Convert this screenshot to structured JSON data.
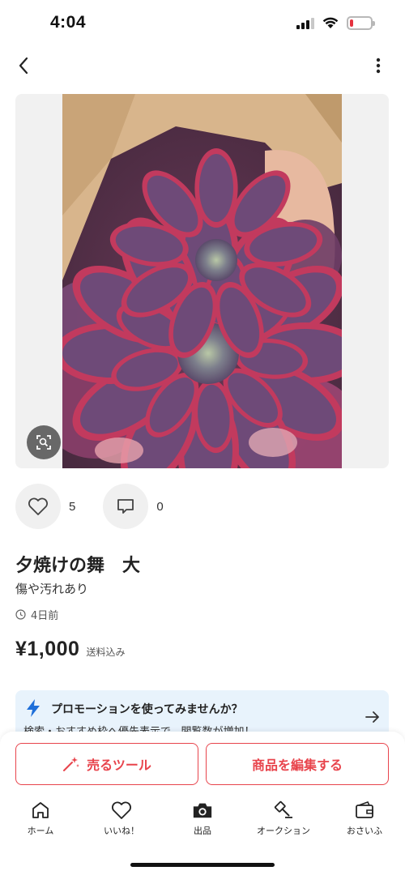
{
  "status_bar": {
    "time": "4:04",
    "battery_level": 0.15
  },
  "header": {
    "back_icon": "chevron-left-icon",
    "menu_icon": "more-vertical-icon"
  },
  "product": {
    "image_description_icon": "succulent-photo",
    "lens_icon": "image-search-icon",
    "likes": "5",
    "comments": "0",
    "title": "夕焼けの舞　大",
    "condition": "傷や汚れあり",
    "posted": "4日前",
    "price": "¥1,000",
    "shipping": "送料込み"
  },
  "promo": {
    "title": "プロモーションを使ってみませんか？",
    "subtitle": "検索・おすすめ枠へ優先表示で、閲覧数が増加！",
    "icon": "bolt-icon",
    "arrow_icon": "arrow-right-icon",
    "accent": "#1e6fd9"
  },
  "actions": {
    "sell_tool": "売るツール",
    "edit_item": "商品を編集する",
    "accent": "#e8444c"
  },
  "tabs": [
    {
      "label": "ホーム",
      "icon": "home-icon"
    },
    {
      "label": "いいね！",
      "icon": "heart-icon"
    },
    {
      "label": "出品",
      "icon": "camera-icon"
    },
    {
      "label": "オークション",
      "icon": "gavel-icon"
    },
    {
      "label": "おさいふ",
      "icon": "wallet-icon"
    }
  ]
}
